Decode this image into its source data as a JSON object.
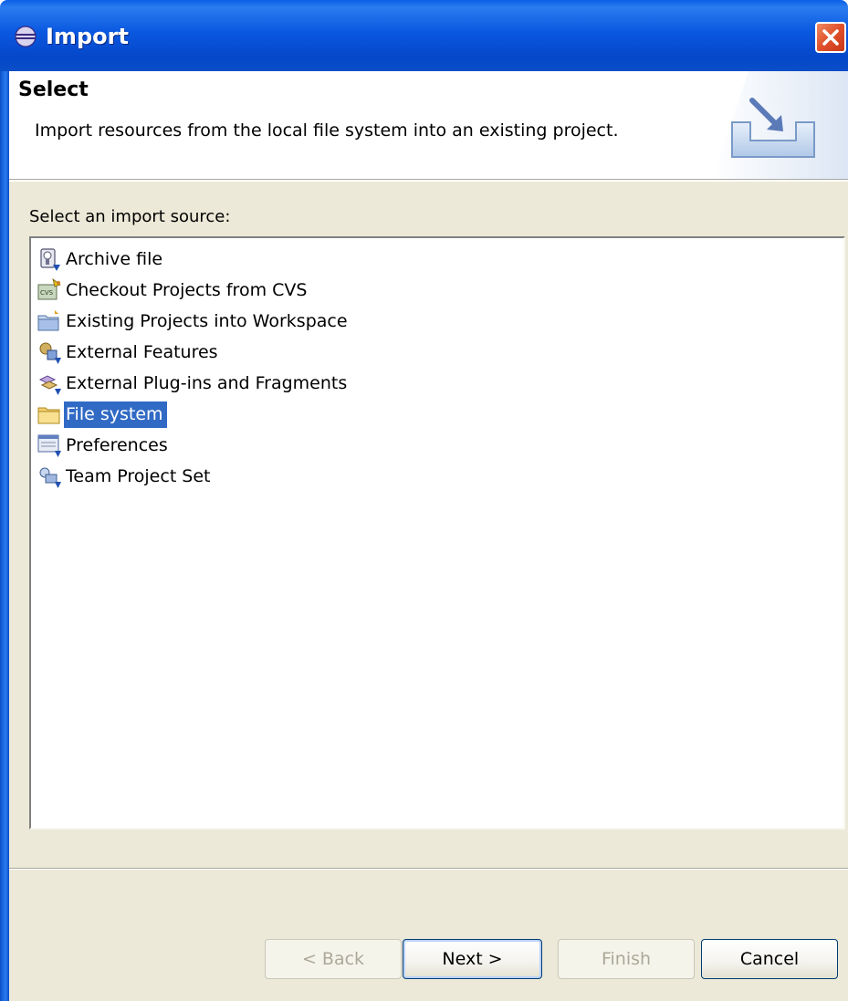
{
  "window": {
    "title": "Import"
  },
  "banner": {
    "title": "Select",
    "description": "Import resources from the local file system into an existing project."
  },
  "import_source": {
    "label": "Select an import source:",
    "items": [
      {
        "label": "Archive file",
        "icon": "archive-file-icon",
        "selected": false
      },
      {
        "label": "Checkout Projects from CVS",
        "icon": "cvs-icon",
        "selected": false
      },
      {
        "label": "Existing Projects into Workspace",
        "icon": "project-folder-icon",
        "selected": false
      },
      {
        "label": "External Features",
        "icon": "external-features-icon",
        "selected": false
      },
      {
        "label": "External Plug-ins and Fragments",
        "icon": "plugins-icon",
        "selected": false
      },
      {
        "label": "File system",
        "icon": "folder-icon",
        "selected": true
      },
      {
        "label": "Preferences",
        "icon": "preferences-icon",
        "selected": false
      },
      {
        "label": "Team Project Set",
        "icon": "team-project-set-icon",
        "selected": false
      }
    ]
  },
  "buttons": {
    "back": "< Back",
    "next": "Next >",
    "finish": "Finish",
    "cancel": "Cancel"
  },
  "colors": {
    "titlebar": "#0a58e0",
    "selection": "#316ac5",
    "dialog_bg": "#ece9d8"
  }
}
